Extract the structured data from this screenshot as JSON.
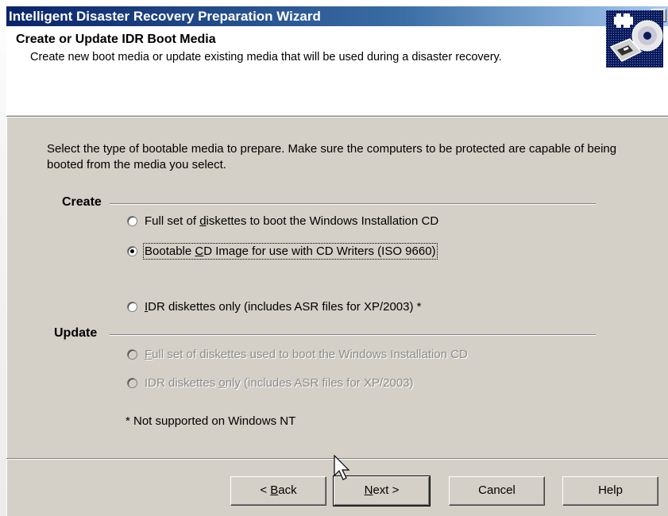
{
  "window": {
    "title": "Intelligent Disaster Recovery Preparation Wizard",
    "close_glyph": "✕"
  },
  "header": {
    "title": "Create or Update IDR Boot Media",
    "description": "Create new boot media or update existing media that will be used during a disaster recovery.",
    "icon": "disk-cd-icon"
  },
  "instructions": "Select the type of bootable media to prepare. Make sure the computers to be protected are capable of being booted from the media you select.",
  "create_group": {
    "label": "Create",
    "options": [
      {
        "pre": "Full set of ",
        "key": "d",
        "post": "iskettes to boot the Windows Installation CD",
        "selected": false,
        "enabled": true
      },
      {
        "pre": "Bootable ",
        "key": "C",
        "post": "D Image for use with CD Writers (ISO 9660)",
        "selected": true,
        "enabled": true
      },
      {
        "pre": "",
        "key": "I",
        "post": "DR diskettes only (includes ASR files for XP/2003) *",
        "selected": false,
        "enabled": true
      }
    ]
  },
  "update_group": {
    "label": "Update",
    "options": [
      {
        "pre": "",
        "key": "F",
        "post": "ull set of diskettes used to boot the Windows Installation CD",
        "selected": false,
        "enabled": false
      },
      {
        "pre": "IDR diskettes ",
        "key": "o",
        "post": "nly (includes ASR files for XP/2003)",
        "selected": false,
        "enabled": false
      }
    ]
  },
  "note": "* Not supported on Windows NT",
  "buttons": {
    "back": {
      "pre": "< ",
      "key": "B",
      "post": "ack"
    },
    "next": {
      "pre": "",
      "key": "N",
      "post": "ext >"
    },
    "cancel": "Cancel",
    "help": "Help"
  }
}
